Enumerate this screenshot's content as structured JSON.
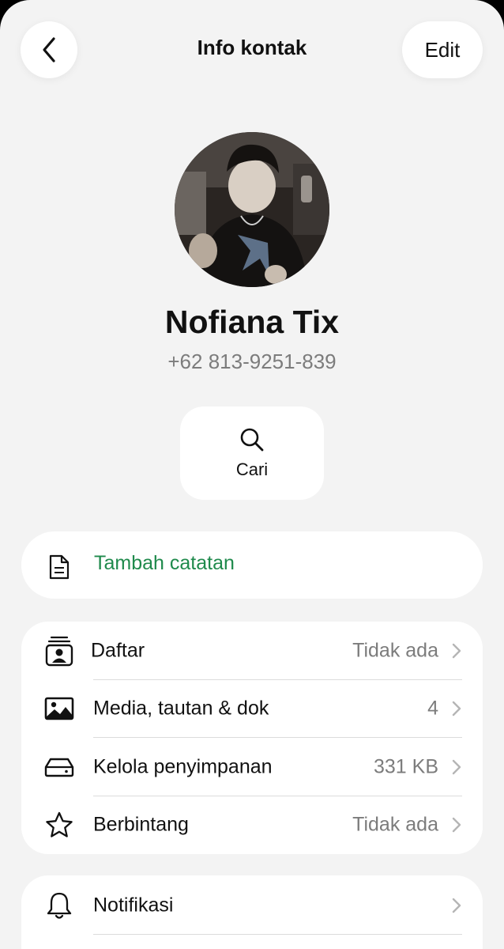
{
  "header": {
    "back_icon": "chevron-left-icon",
    "title": "Info kontak",
    "edit_label": "Edit"
  },
  "contact": {
    "name": "Nofiana Tix",
    "phone": "+62 813-9251-839"
  },
  "actions": {
    "search_icon": "search-icon",
    "search_label": "Cari"
  },
  "note": {
    "icon": "document-icon",
    "label": "Tambah catatan",
    "color": "#1f8a4c"
  },
  "list1": [
    {
      "icon": "contact-list-icon",
      "label": "Daftar",
      "value": "Tidak ada"
    },
    {
      "icon": "photo-icon",
      "label": "Media, tautan & dok",
      "value": "4"
    },
    {
      "icon": "storage-icon",
      "label": "Kelola penyimpanan",
      "value": "331 KB"
    },
    {
      "icon": "star-icon",
      "label": "Berbintang",
      "value": "Tidak ada"
    }
  ],
  "list2": [
    {
      "icon": "bell-icon",
      "label": "Notifikasi",
      "value": ""
    }
  ],
  "colors": {
    "background": "#f3f3f3",
    "card": "#ffffff",
    "accent_green": "#1f8a4c",
    "secondary_text": "#7c7c7c"
  }
}
